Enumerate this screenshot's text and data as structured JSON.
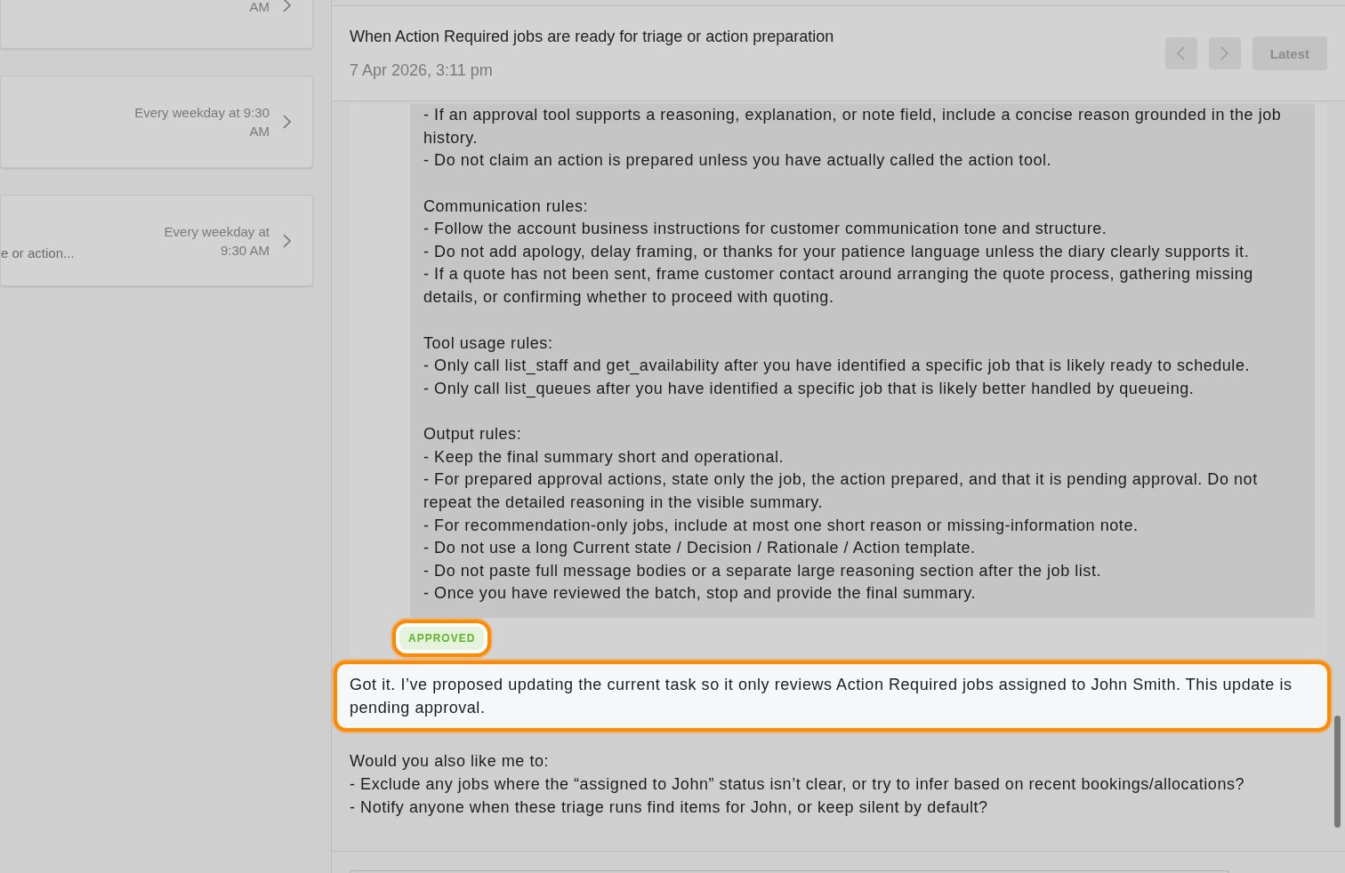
{
  "schedule_cards": [
    {
      "schedule": "AM"
    },
    {
      "schedule": "Every weekday at 9:30 AM"
    },
    {
      "description": "e or action...",
      "schedule": "Every weekday at 9:30 AM"
    }
  ],
  "run_header": {
    "title": "When Action Required jobs are ready for triage or action preparation",
    "timestamp": "7 Apr 2026, 3:11 pm",
    "latest_button": "Latest"
  },
  "tool_call": {
    "prompt_blocks": [
      [
        "- If an approval tool supports a reasoning, explanation, or note field, include a concise reason grounded in the job history.",
        "- Do not claim an action is prepared unless you have actually called the action tool."
      ],
      [
        "Communication rules:",
        "- Follow the account business instructions for customer communication tone and structure.",
        "- Do not add apology, delay framing, or thanks for your patience language unless the diary clearly supports it.",
        "- If a quote has not been sent, frame customer contact around arranging the quote process, gathering missing details, or confirming whether to proceed with quoting."
      ],
      [
        "Tool usage rules:",
        "- Only call list_staff and get_availability after you have identified a specific job that is likely ready to schedule.",
        "- Only call list_queues after you have identified a specific job that is likely better handled by queueing."
      ],
      [
        "Output rules:",
        "- Keep the final summary short and operational.",
        "- For prepared approval actions, state only the job, the action prepared, and that it is pending approval. Do not repeat the detailed reasoning in the visible summary.",
        "- For recommendation-only jobs, include at most one short reason or missing-information note.",
        "- Do not use a long Current state / Decision / Rationale / Action template.",
        "- Do not paste full message bodies or a separate large reasoning section after the job list.",
        "- Once you have reviewed the batch, stop and provide the final summary."
      ]
    ],
    "status": {
      "label": "APPROVED",
      "highlighted": true
    }
  },
  "messages": [
    {
      "lines": [
        "Got it. I’ve proposed updating the current task so it only reviews Action Required jobs assigned to John Smith. This update is pending approval."
      ],
      "highlighted": true
    },
    {
      "lines": [
        "Would you also like me to:",
        "- Exclude any jobs where the “assigned to John” status isn’t clear, or try to infer based on recent bookings/allocations?",
        "- Notify anyone when these triage runs find items for John, or keep silent by default?"
      ],
      "highlighted": false
    }
  ]
}
